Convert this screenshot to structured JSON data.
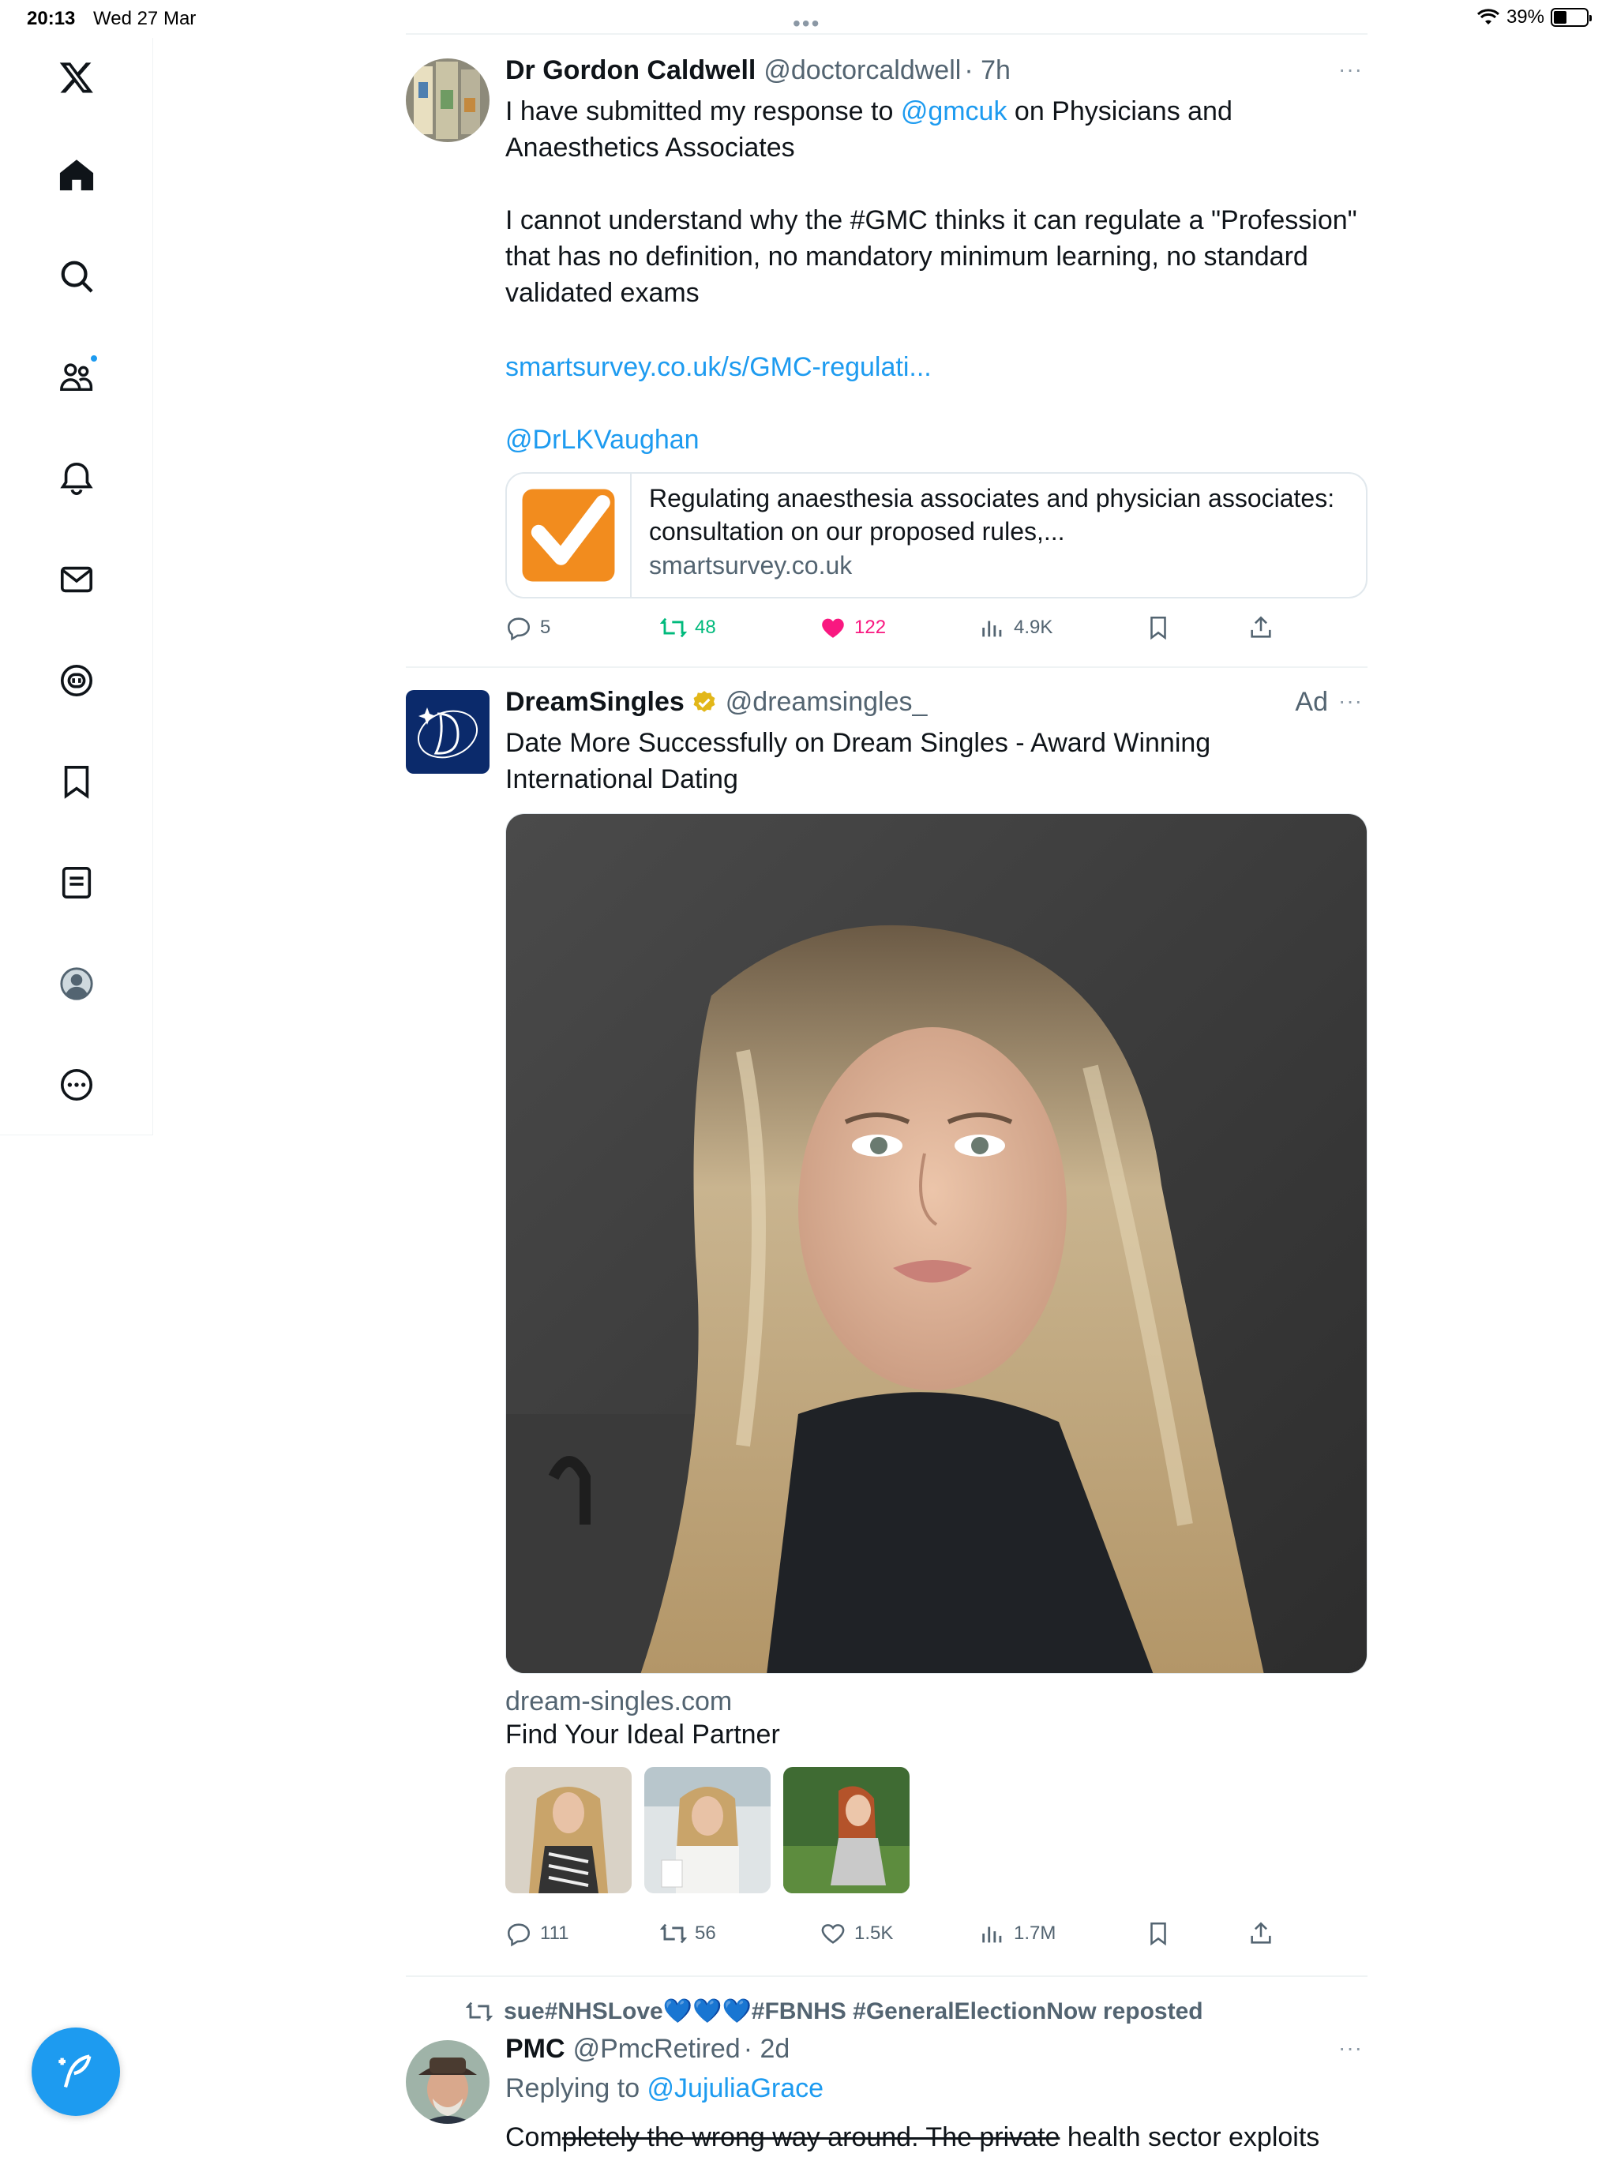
{
  "status_bar": {
    "time": "20:13",
    "date": "Wed 27 Mar",
    "battery": "39%",
    "battery_level": 0.39
  },
  "sidebar": {
    "items": [
      {
        "name": "x-logo-icon"
      },
      {
        "name": "home-icon"
      },
      {
        "name": "search-icon"
      },
      {
        "name": "communities-icon"
      },
      {
        "name": "notifications-icon"
      },
      {
        "name": "messages-icon"
      },
      {
        "name": "grok-icon"
      },
      {
        "name": "bookmarks-icon"
      },
      {
        "name": "lists-icon"
      },
      {
        "name": "profile-icon"
      },
      {
        "name": "more-icon"
      }
    ],
    "compose_icon": "compose-feather-icon"
  },
  "tweets": [
    {
      "name": "Dr Gordon Caldwell",
      "handle": "@doctorcaldwell",
      "time": "· 7h",
      "more": "···",
      "text_before": "I have submitted my response to ",
      "mention_1": "@gmcuk",
      "text_after": " on Physicians and Anaesthetics Associates\n\nI cannot understand why the #GMC thinks it can regulate a \"Profession\" that has no definition, no mandatory minimum learning, no standard validated exams",
      "link": "smartsurvey.co.uk/s/GMC-regulati...",
      "mention_2": "@DrLKVaughan",
      "card": {
        "title": "Regulating anaesthesia associates and physician associates: consultation on our proposed rules,...",
        "domain": "smartsurvey.co.uk"
      },
      "stats": {
        "replies": "5",
        "reposts": "48",
        "likes": "122",
        "views": "4.9K"
      }
    },
    {
      "name": "DreamSingles",
      "handle": "@dreamsingles_",
      "ad_label": "Ad",
      "more": "···",
      "text": "Date More Successfully on Dream Singles - Award Winning International Dating",
      "domain": "dream-singles.com",
      "tagline": "Find Your Ideal Partner",
      "stats": {
        "replies": "111",
        "reposts": "56",
        "likes": "1.5K",
        "views": "1.7M"
      }
    },
    {
      "repost_by": "sue#NHSLove💙💙💙#FBNHS #GeneralElectionNow reposted",
      "name": "PMC",
      "handle": "@PmcRetired",
      "time": "· 2d",
      "more": "···",
      "replying_prefix": "Replying to ",
      "replying_to": "@JujuliaGrace",
      "text_normal_1": "Com",
      "text_strike": "pletely the wrong way around. The private",
      "text_normal_2": " health sector exploits"
    }
  ],
  "colors": {
    "accent": "#1d9bf0",
    "repost": "#00ba7c",
    "like": "#f91880",
    "secondary_text": "#536471",
    "divider": "#eff3f4"
  }
}
